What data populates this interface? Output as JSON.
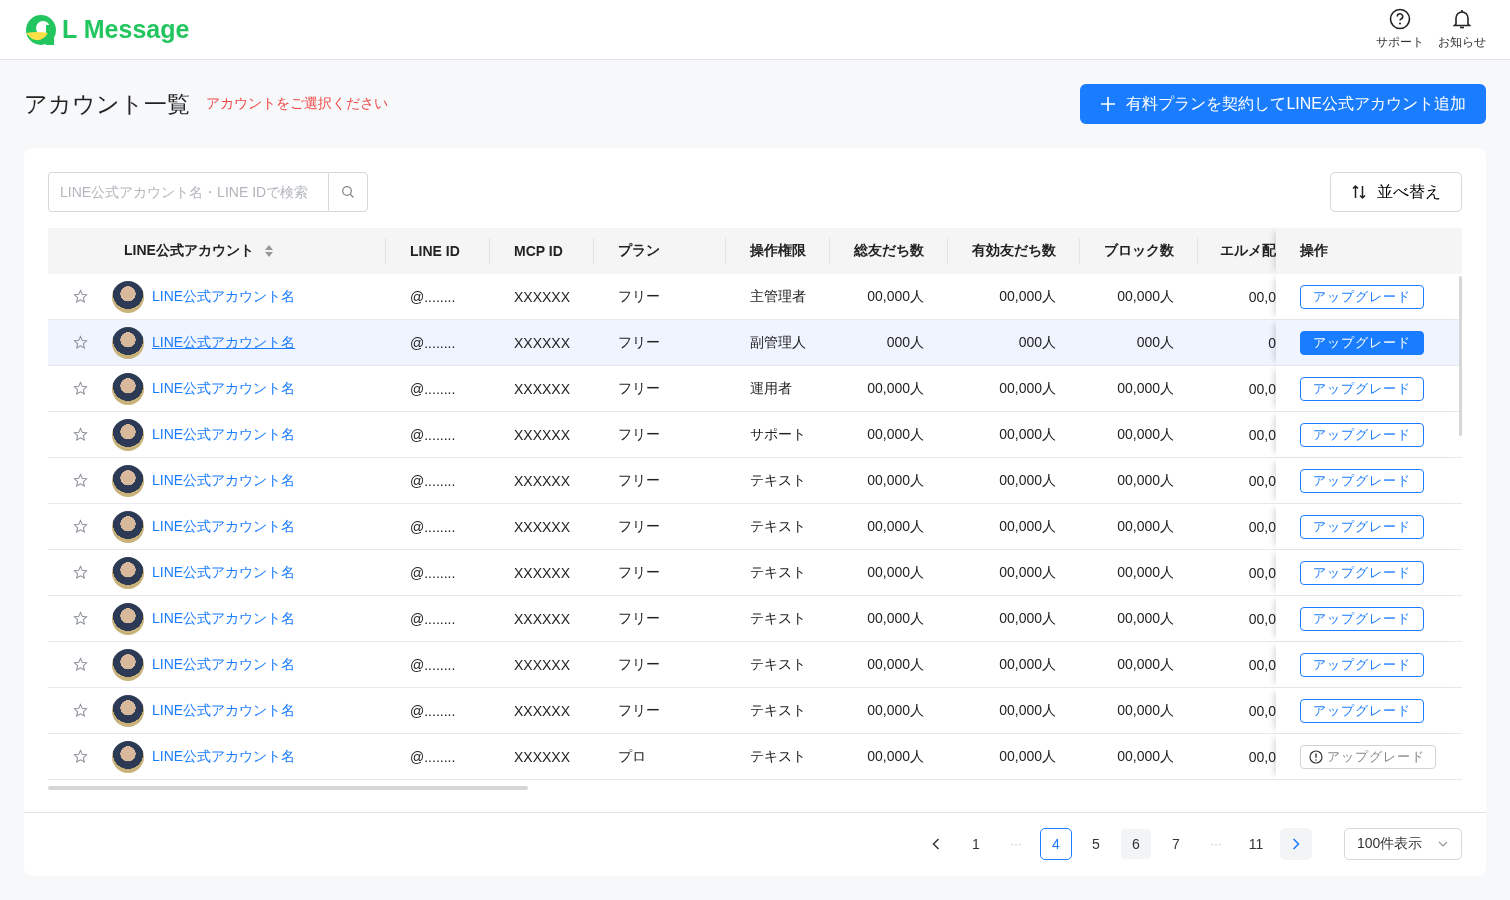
{
  "header": {
    "logo_text": "L Message",
    "nav": [
      {
        "label": "サポート"
      },
      {
        "label": "お知らせ"
      }
    ]
  },
  "page": {
    "title": "アカウント一覧",
    "hint": "アカウントをご選択ください",
    "add_button": "有料プランを契約してLINE公式アカウント追加"
  },
  "toolbar": {
    "search": {
      "placeholder": "LINE公式アカウント名・LINE IDで検索"
    },
    "sort_button": "並べ替え"
  },
  "table": {
    "columns": [
      {
        "label": "LINE公式アカウント",
        "sortable": true
      },
      {
        "label": "LINE ID",
        "sortable": false
      },
      {
        "label": "MCP ID",
        "sortable": false
      },
      {
        "label": "プラン",
        "sortable": false
      },
      {
        "label": "操作権限",
        "sortable": false
      },
      {
        "label": "総友だち数",
        "sortable": false
      },
      {
        "label": "有効友だち数",
        "sortable": false
      },
      {
        "label": "ブロック数",
        "sortable": false
      },
      {
        "label": "エルメ配",
        "sortable": false
      },
      {
        "label": "操作",
        "sortable": false
      }
    ],
    "rows": [
      {
        "starred": false,
        "selected": false,
        "name": "LINE公式アカウント名",
        "line_id": "@........",
        "mcp_id": "XXXXXX",
        "plan": "フリー",
        "role": "主管理者",
        "total": "00,000人",
        "active": "00,000人",
        "blocked": "00,000人",
        "column_9": "00,0",
        "action": "アップグレード",
        "disabled": false
      },
      {
        "starred": false,
        "selected": true,
        "name": "LINE公式アカウント名",
        "line_id": "@........",
        "mcp_id": "XXXXXX",
        "plan": "フリー",
        "role": "副管理人",
        "total": "000人",
        "active": "000人",
        "blocked": "000人",
        "column_9": "0",
        "action": "アップグレード",
        "disabled": false
      },
      {
        "starred": false,
        "selected": false,
        "name": "LINE公式アカウント名",
        "line_id": "@........",
        "mcp_id": "XXXXXX",
        "plan": "フリー",
        "role": "運用者",
        "total": "00,000人",
        "active": "00,000人",
        "blocked": "00,000人",
        "column_9": "00,0",
        "action": "アップグレード",
        "disabled": false
      },
      {
        "starred": false,
        "selected": false,
        "name": "LINE公式アカウント名",
        "line_id": "@........",
        "mcp_id": "XXXXXX",
        "plan": "フリー",
        "role": "サポート",
        "total": "00,000人",
        "active": "00,000人",
        "blocked": "00,000人",
        "column_9": "00,0",
        "action": "アップグレード",
        "disabled": false
      },
      {
        "starred": false,
        "selected": false,
        "name": "LINE公式アカウント名",
        "line_id": "@........",
        "mcp_id": "XXXXXX",
        "plan": "フリー",
        "role": "テキスト",
        "total": "00,000人",
        "active": "00,000人",
        "blocked": "00,000人",
        "column_9": "00,0",
        "action": "アップグレード",
        "disabled": false
      },
      {
        "starred": false,
        "selected": false,
        "name": "LINE公式アカウント名",
        "line_id": "@........",
        "mcp_id": "XXXXXX",
        "plan": "フリー",
        "role": "テキスト",
        "total": "00,000人",
        "active": "00,000人",
        "blocked": "00,000人",
        "column_9": "00,0",
        "action": "アップグレード",
        "disabled": false
      },
      {
        "starred": false,
        "selected": false,
        "name": "LINE公式アカウント名",
        "line_id": "@........",
        "mcp_id": "XXXXXX",
        "plan": "フリー",
        "role": "テキスト",
        "total": "00,000人",
        "active": "00,000人",
        "blocked": "00,000人",
        "column_9": "00,0",
        "action": "アップグレード",
        "disabled": false
      },
      {
        "starred": false,
        "selected": false,
        "name": "LINE公式アカウント名",
        "line_id": "@........",
        "mcp_id": "XXXXXX",
        "plan": "フリー",
        "role": "テキスト",
        "total": "00,000人",
        "active": "00,000人",
        "blocked": "00,000人",
        "column_9": "00,0",
        "action": "アップグレード",
        "disabled": false
      },
      {
        "starred": false,
        "selected": false,
        "name": "LINE公式アカウント名",
        "line_id": "@........",
        "mcp_id": "XXXXXX",
        "plan": "フリー",
        "role": "テキスト",
        "total": "00,000人",
        "active": "00,000人",
        "blocked": "00,000人",
        "column_9": "00,0",
        "action": "アップグレード",
        "disabled": false
      },
      {
        "starred": false,
        "selected": false,
        "name": "LINE公式アカウント名",
        "line_id": "@........",
        "mcp_id": "XXXXXX",
        "plan": "フリー",
        "role": "テキスト",
        "total": "00,000人",
        "active": "00,000人",
        "blocked": "00,000人",
        "column_9": "00,0",
        "action": "アップグレード",
        "disabled": false
      },
      {
        "starred": false,
        "selected": false,
        "name": "LINE公式アカウント名",
        "line_id": "@........",
        "mcp_id": "XXXXXX",
        "plan": "プロ",
        "role": "テキスト",
        "total": "00,000人",
        "active": "00,000人",
        "blocked": "00,000人",
        "column_9": "00,0",
        "action": "アップグレード",
        "disabled": true
      }
    ]
  },
  "pagination": {
    "pages": [
      {
        "kind": "page",
        "label": "1",
        "selected": false,
        "hovered": false
      },
      {
        "kind": "ellipsis",
        "label": "···"
      },
      {
        "kind": "page",
        "label": "4",
        "selected": true,
        "hovered": false
      },
      {
        "kind": "page",
        "label": "5",
        "selected": false,
        "hovered": false
      },
      {
        "kind": "page",
        "label": "6",
        "selected": false,
        "hovered": true
      },
      {
        "kind": "page",
        "label": "7",
        "selected": false,
        "hovered": false
      },
      {
        "kind": "ellipsis",
        "label": "···"
      },
      {
        "kind": "page",
        "label": "11",
        "selected": false,
        "hovered": false
      }
    ],
    "page_size": "100件表示"
  }
}
